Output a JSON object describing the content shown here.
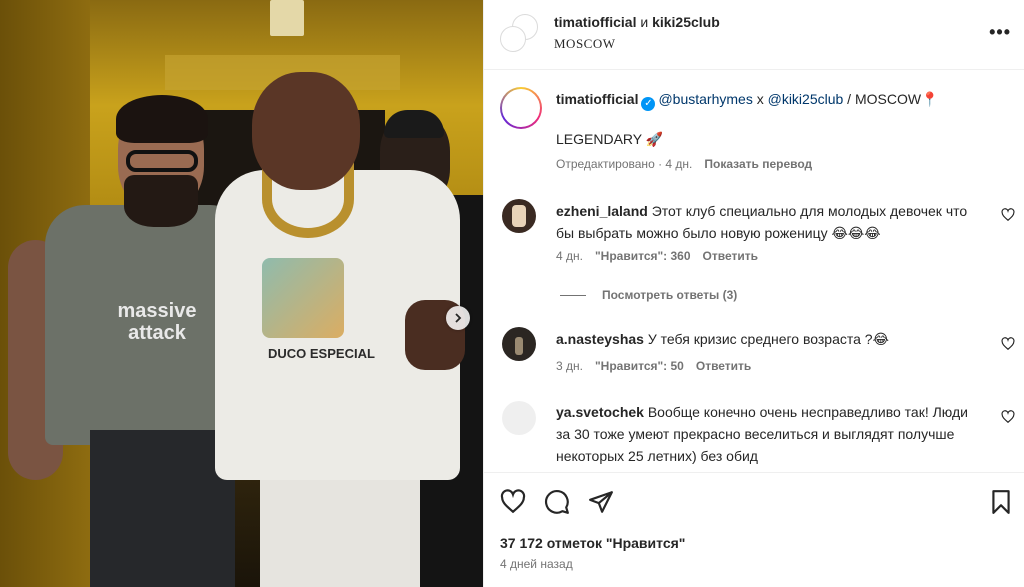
{
  "post": {
    "header": {
      "user1": "timatiofficial",
      "connector": " и ",
      "user2": "kiki25club",
      "location": "MOSCOW",
      "more_icon": "more-horizontal-icon"
    },
    "caption": {
      "username": "timatiofficial",
      "mention1": "@bustarhymes",
      "connector": " x ",
      "mention2": "@kiki25club",
      "suffix": " / MOSCOW📍",
      "text": "LEGENDARY 🚀",
      "edited": "Отредактировано · 4 дн.",
      "translate": "Показать перевод"
    },
    "photo": {
      "shirt_text_1": "massive",
      "shirt_text_2": "attack",
      "shirt_text_3": "DUCO ESPECIAL"
    },
    "comments": [
      {
        "username": "ezheni_laland",
        "text": "Этот клуб специально для молодых девочек что бы выбрать можно было новую роженицу 😂😂😂",
        "age": "4 дн.",
        "likes": "\"Нравится\": 360",
        "reply": "Ответить"
      },
      {
        "username": "a.nasteyshas",
        "text": "У тебя кризис среднего возраста ?😂",
        "age": "3 дн.",
        "likes": "\"Нравится\": 50",
        "reply": "Ответить"
      },
      {
        "username": "ya.svetochek",
        "text": "Вообще конечно очень несправедливо так! Люди за 30 тоже умеют прекрасно веселиться и выглядят получше некоторых 25 летних) без обид"
      }
    ],
    "view_replies": "Посмотреть ответы (3)",
    "likes_count": "37 172 отметок \"Нравится\"",
    "posted": "4 дней назад",
    "colors": {
      "link": "#00376b",
      "verified": "#0095f6",
      "muted": "#737373"
    }
  }
}
